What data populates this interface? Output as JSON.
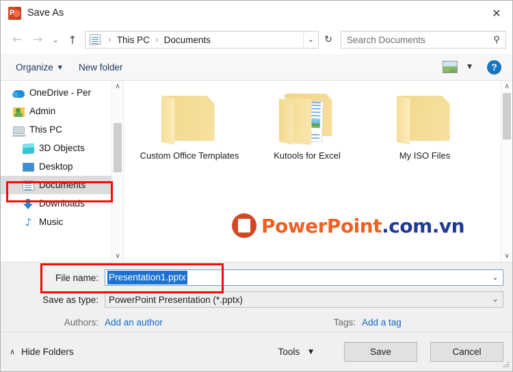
{
  "window": {
    "title": "Save As",
    "app_icon": "powerpoint-icon",
    "close_label": "✕"
  },
  "nav": {
    "back": "←",
    "forward": "→",
    "recent": "⌄",
    "up": "↑",
    "refresh": "↻",
    "address_chevron": "⌄",
    "breadcrumb": [
      "This PC",
      "Documents"
    ],
    "separator": "›"
  },
  "search": {
    "placeholder": "Search Documents",
    "icon": "search-icon",
    "glyph": "⚲"
  },
  "commandbar": {
    "organize_label": "Organize",
    "organize_caret": "▼",
    "new_folder_label": "New folder",
    "view_caret": "▼",
    "help_label": "?"
  },
  "sidebar": {
    "items": [
      {
        "label": "OneDrive - Per",
        "icon": "onedrive-icon",
        "indent": 18,
        "selected": false
      },
      {
        "label": "Admin",
        "icon": "user-folder-icon",
        "indent": 18,
        "selected": false
      },
      {
        "label": "This PC",
        "icon": "computer-icon",
        "indent": 18,
        "selected": false
      },
      {
        "label": "3D Objects",
        "icon": "3d-objects-icon",
        "indent": 32,
        "selected": false
      },
      {
        "label": "Desktop",
        "icon": "desktop-icon",
        "indent": 32,
        "selected": false
      },
      {
        "label": "Documents",
        "icon": "documents-icon",
        "indent": 32,
        "selected": true
      },
      {
        "label": "Downloads",
        "icon": "downloads-icon",
        "indent": 32,
        "selected": false
      },
      {
        "label": "Music",
        "icon": "music-icon",
        "indent": 32,
        "selected": false
      }
    ],
    "scroll_up": "∧",
    "scroll_down": "∨"
  },
  "files": {
    "items": [
      {
        "name": "Custom Office Templates",
        "type": "folder-empty"
      },
      {
        "name": "Kutools for Excel",
        "type": "folder-with-contents"
      },
      {
        "name": "My ISO Files",
        "type": "folder-empty"
      }
    ],
    "scroll_up": "∧",
    "scroll_down": "∨"
  },
  "watermark": {
    "text_part1": "PowerPoint",
    "text_part2": ".com.vn",
    "color1": "#ee6123",
    "color2": "#1f3a93",
    "badge_color": "#d24726"
  },
  "form": {
    "filename_label": "File name:",
    "filename_value": "Presentation1.pptx",
    "filename_chevron": "⌄",
    "savetype_label": "Save as type:",
    "savetype_value": "PowerPoint Presentation (*.pptx)",
    "savetype_chevron": "⌄",
    "authors_label": "Authors:",
    "authors_link": "Add an author",
    "tags_label": "Tags:",
    "tags_link": "Add a tag"
  },
  "footer": {
    "hide_folders_label": "Hide Folders",
    "hide_folders_caret": "∧",
    "tools_label": "Tools",
    "tools_caret": "▼",
    "save_label": "Save",
    "cancel_label": "Cancel"
  },
  "highlights": {
    "accent_color": "#f60a0a",
    "selection_color": "#1b72d0"
  }
}
